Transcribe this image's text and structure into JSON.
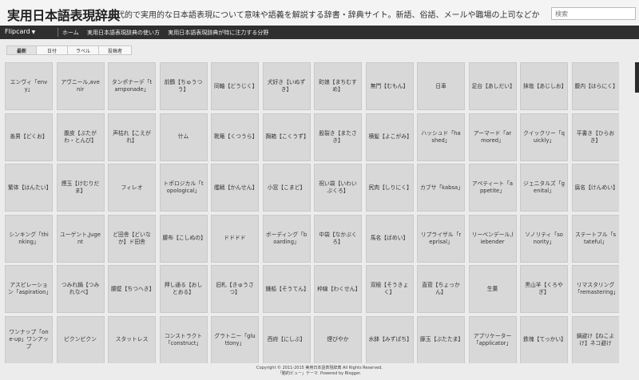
{
  "header": {
    "title": "実用日本語表現辞典",
    "description": "現代的で実用的な日本語表現について意味や語義を解説する辞書・辞典サイト。新語、俗語、メールや職場の上司などか...",
    "search_placeholder": "検索"
  },
  "nav": {
    "flipcard": "Flipcard",
    "caret": "▼",
    "links": [
      "ホーム",
      "実用日本語表現辞典の使い方",
      "実用日本語表現辞典が特に注力する分野"
    ]
  },
  "tabs": [
    "最新",
    "日付",
    "ラベル",
    "投稿者"
  ],
  "cards": [
    "エンヴィ「envy」",
    "アヴニール,avenir",
    "タンポナーデ「tamponade」",
    "前鶴【ちゅうつう】",
    "同軸【どうじく】",
    "犬好き【いぬずき】",
    "町娘【まちむすめ】",
    "無門【むもん】",
    "日車",
    "足台【あしだい】",
    "抹塩【あじしお】",
    "腹内【はらにく】",
    "善男【どくお】",
    "腹皮【ぶたがわ・とんぴ】",
    "声枯れ【こえがれ】",
    "什ム",
    "靴篭【くつうら】",
    "麹箱【こくうず】",
    "股裂き【またさき】",
    "横髪【よこがみ】",
    "ハッシュド「hashed」",
    "アーマード「armored」",
    "クイックリー「quickly」",
    "平書き【ひらおき】",
    "繁体【はんたい】",
    "煙玉【けむりだま】",
    "フィレオ",
    "トポロジカル「topological」",
    "艦戦【かんせん】",
    "小窓【こまど】",
    "祝い袋【いわいぶくろ】",
    "尻肉【しりにく】",
    "カブサ「kabsa」",
    "アペティート「appetite」",
    "ジェニタルズ「genital」",
    "腐名【けんめい】",
    "シンキング「thinking」",
    "ユーゲント,Jugent",
    "ど田舎【どいなか】ド田舎",
    "腰布【こしぬの】",
    "ドドドド",
    "ボーディング「boarding」",
    "中袋【なかぶくろ】",
    "馬名【ばめい】",
    "リプライザル「reprisal」",
    "リーベンデール,liebender",
    "ソノリティ「sonority」",
    "ステートフル「stateful」",
    "アスピレーション「aspiration」",
    "つみれ鍋【つみれなべ】",
    "腰壁【ちつへき】",
    "押し通る【おしとおる】",
    "旧札【きゅうさつ】",
    "鎌船【そうてん】",
    "枠線【わくせん】",
    "双極【そうきょく】",
    "直菅【ちょっかん】",
    "生菓",
    "黒山羊【くろやぎ】",
    "リマスタリング「remastering」",
    "ワンナップ「one-up」ワンアップ",
    "ピクンピクン",
    "スタットレス",
    "コンストラクト「construct」",
    "グラトニー「gluttony」",
    "西府【にしぶ】",
    "煙びやか",
    "水鉢【みずばち】",
    "豚玉【ぶたたま】",
    "アプリケーター「applicator」",
    "鉄塊【てっかい】",
    "鍋避け【ねこよけ】ネコ避け"
  ],
  "footer": {
    "line1": "Copyright © 2011-2015 実用日本語表現辞典 All Rights Reserved.",
    "line2": "「動的ビュー」テーマ. Powered by Blogger."
  }
}
